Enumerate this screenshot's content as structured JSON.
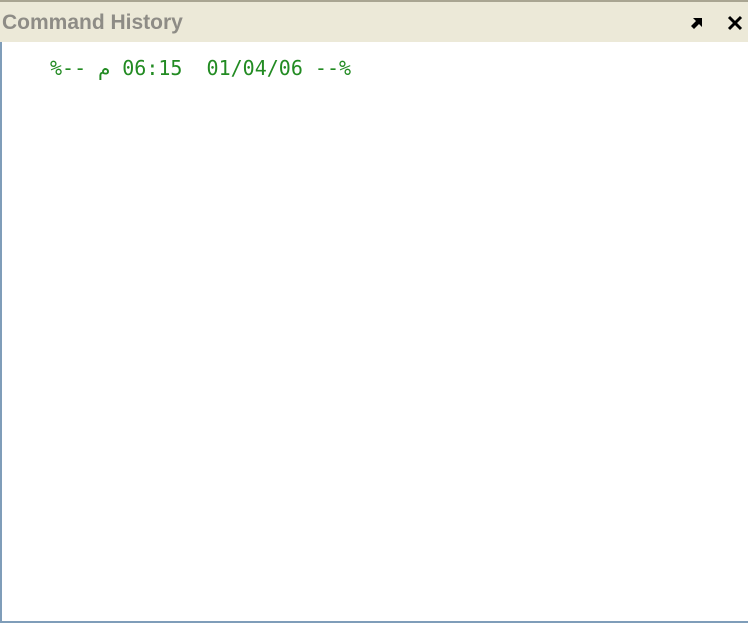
{
  "window": {
    "title": "Command History"
  },
  "history": {
    "entries": [
      "%-- م 06:15  01/04/06 --%"
    ]
  },
  "icons": {
    "undock": "undock-arrow-icon",
    "close": "close-icon"
  },
  "colors": {
    "titlebar_bg": "#ece9d8",
    "title_text": "#8e8c86",
    "history_text": "#228b22",
    "border": "#7f9db9"
  }
}
